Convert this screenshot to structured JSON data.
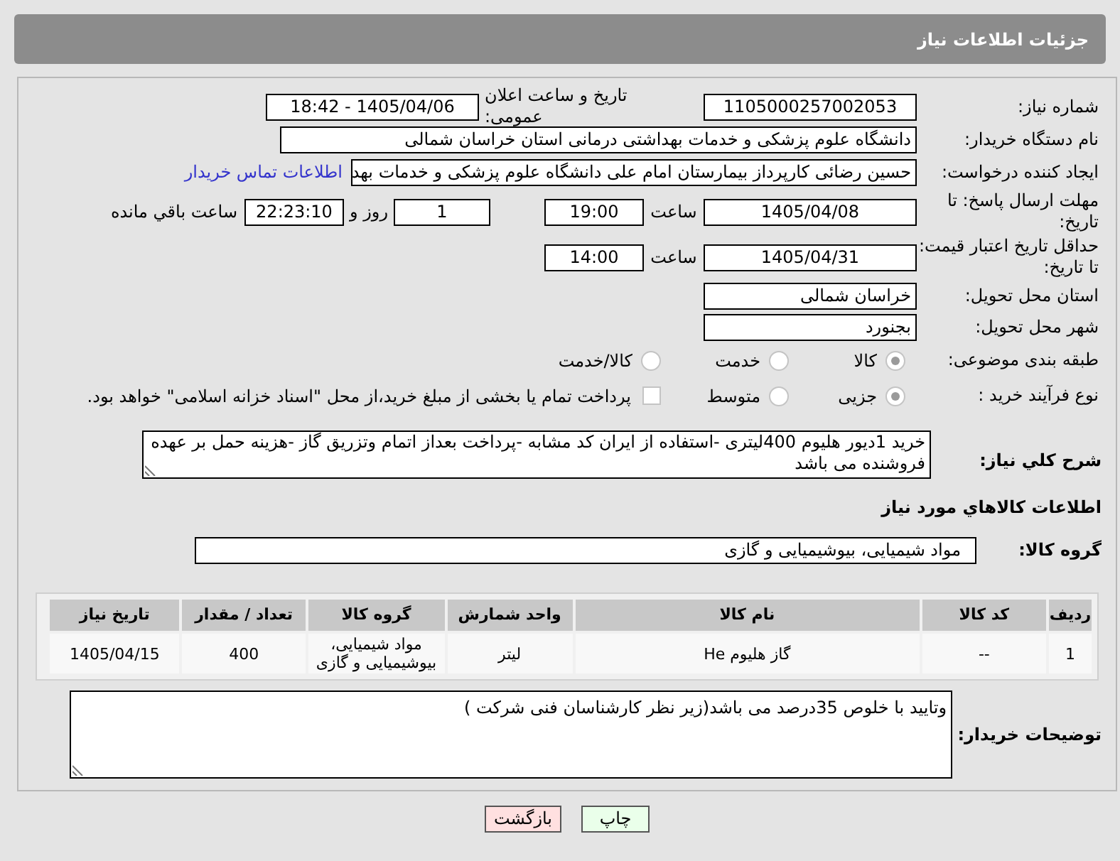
{
  "header": {
    "title": "جزئیات اطلاعات نیاز"
  },
  "need_number": {
    "label": "شماره نیاز:",
    "value": "1105000257002053"
  },
  "announce": {
    "label": "تاریخ و ساعت اعلان عمومی:",
    "value": "1405/04/06 - 18:42"
  },
  "buyer_org": {
    "label": "نام دستگاه خریدار:",
    "value": "دانشگاه علوم پزشکی و خدمات بهداشتی درمانی استان خراسان شمالی"
  },
  "requester": {
    "label": "ایجاد کننده درخواست:",
    "value": "حسین رضائی کارپرداز بیمارستان امام علی دانشگاه علوم پزشکی و خدمات بهد",
    "link": "اطلاعات تماس خریدار"
  },
  "reply_deadline": {
    "label": "مهلت ارسال پاسخ: تا تاریخ:",
    "date": "1405/04/08",
    "time_label": "ساعت",
    "time": "19:00",
    "days": "1",
    "days_label": "روز و",
    "remaining": "22:23:10",
    "remaining_label": "ساعت باقي مانده"
  },
  "price_validity": {
    "label": "حداقل تاریخ اعتبار قیمت: تا تاریخ:",
    "date": "1405/04/31",
    "time_label": "ساعت",
    "time": "14:00"
  },
  "province": {
    "label": "استان محل تحویل:",
    "value": "خراسان شمالی"
  },
  "city": {
    "label": "شهر محل تحویل:",
    "value": "بجنورد"
  },
  "category": {
    "label": "طبقه بندی موضوعی:",
    "options": [
      {
        "label": "کالا",
        "selected": true
      },
      {
        "label": "خدمت",
        "selected": false
      },
      {
        "label": "کالا/خدمت",
        "selected": false
      }
    ]
  },
  "purchase_type": {
    "label": "نوع فرآیند خرید :",
    "options": [
      {
        "label": "جزیی",
        "selected": true
      },
      {
        "label": "متوسط",
        "selected": false
      }
    ],
    "treasury": {
      "checked": false,
      "text": "پرداخت تمام یا بخشی از مبلغ خرید،از محل \"اسناد خزانه اسلامی\" خواهد بود."
    }
  },
  "description": {
    "label": "شرح کلي نیاز:",
    "value": "خرید 1دیور هلیوم 400لیتری -استفاده از ایران کد مشابه -پرداخت بعداز اتمام وتزریق گاز -هزینه حمل بر عهده فروشنده می باشد"
  },
  "goods_section": {
    "title": "اطلاعات کالاهاي مورد نیاز"
  },
  "goods_group": {
    "label": "گروه کالا:",
    "value": "مواد شیمیایی، بیوشیمیایی و  گازی"
  },
  "table": {
    "columns": [
      "ردیف",
      "کد کالا",
      "نام کالا",
      "واحد شمارش",
      "گروه کالا",
      "تعداد / مقدار",
      "تاریخ نیاز"
    ],
    "rows": [
      [
        "1",
        "--",
        "گاز هلیوم He",
        "لیتر",
        "مواد شیمیایی، بیوشیمیایی و گازی",
        "400",
        "1405/04/15"
      ]
    ]
  },
  "buyer_notes": {
    "label": "توضیحات خریدار:",
    "value": "وتایید با خلوص 35درصد می باشد(زیر نظر کارشناسان فنی شرکت )"
  },
  "buttons": [
    {
      "label": "چاپ",
      "kind": "print"
    },
    {
      "label": "بازگشت",
      "kind": "back"
    }
  ]
}
